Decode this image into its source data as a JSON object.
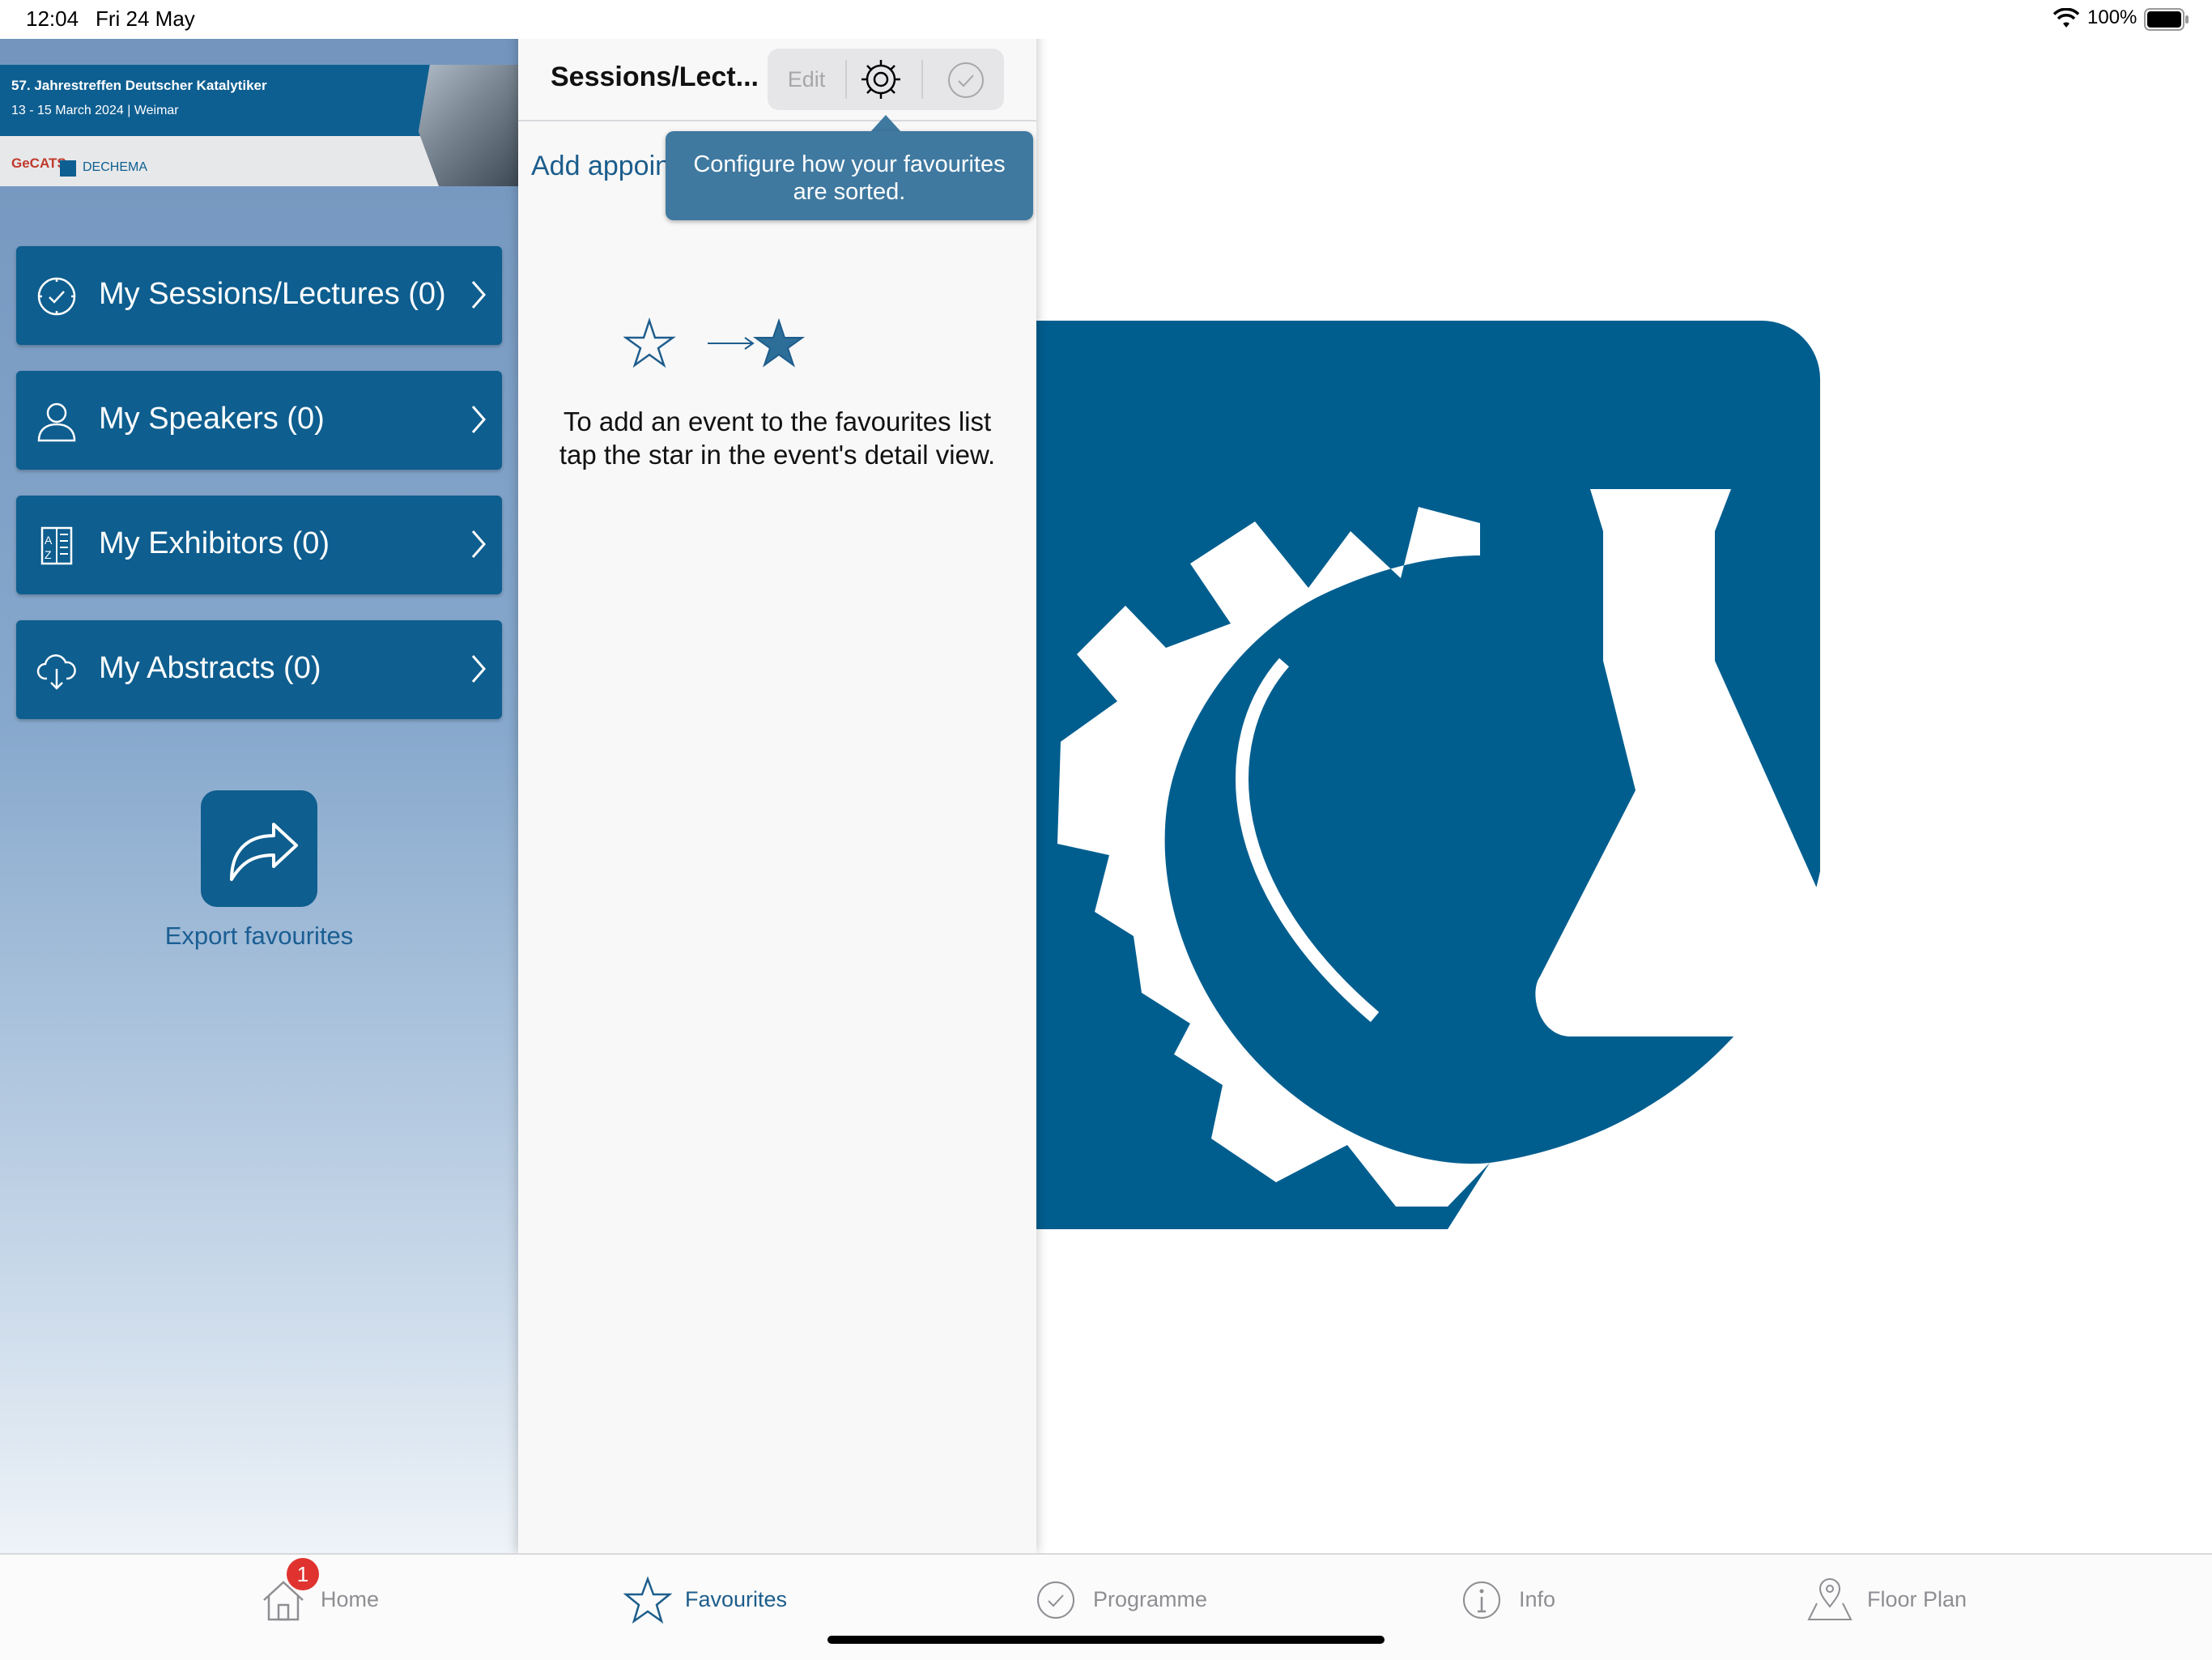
{
  "status_bar": {
    "time": "12:04",
    "date": "Fri 24 May",
    "battery": "100%"
  },
  "banner": {
    "title": "57. Jahrestreffen Deutscher Katalytiker",
    "subtitle": "13 - 15 March 2024 | Weimar",
    "gecats": "GeCATS",
    "dechema": "DECHEMA"
  },
  "sidebar": {
    "items": [
      {
        "label": "My Sessions/Lectures (0)",
        "icon": "clock-check-icon"
      },
      {
        "label": "My Speakers (0)",
        "icon": "person-icon"
      },
      {
        "label": "My Exhibitors (0)",
        "icon": "az-list-icon"
      },
      {
        "label": "My Abstracts (0)",
        "icon": "cloud-download-icon"
      }
    ],
    "export_label": "Export favourites"
  },
  "panel": {
    "title": "Sessions/Lect...",
    "edit_label": "Edit",
    "add_appointment": "Add appointment",
    "tooltip": "Configure how your favourites are sorted.",
    "hint": "To add an event to the favourites list tap the star in the event's detail view."
  },
  "tabbar": {
    "tabs": [
      {
        "label": "Home",
        "icon": "home-icon",
        "badge": "1"
      },
      {
        "label": "Favourites",
        "icon": "star-icon",
        "active": true
      },
      {
        "label": "Programme",
        "icon": "clock-icon"
      },
      {
        "label": "Info",
        "icon": "info-icon"
      },
      {
        "label": "Floor Plan",
        "icon": "map-pin-icon"
      }
    ]
  },
  "colors": {
    "accent": "#0e5e8f",
    "tooltip": "#3f79a0",
    "badge": "#e0332f"
  }
}
